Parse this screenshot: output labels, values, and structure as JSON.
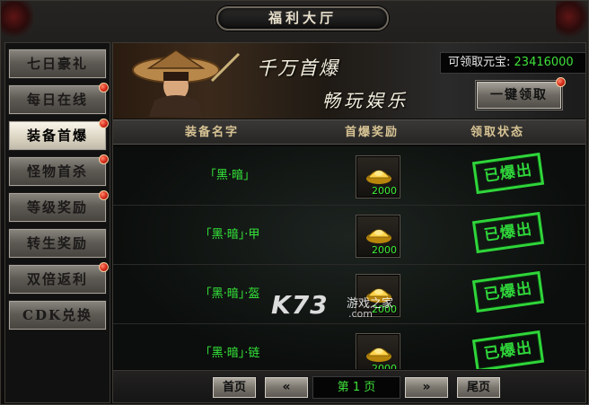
{
  "window": {
    "title": "福利大厅"
  },
  "sidebar": {
    "items": [
      {
        "label": "七日豪礼",
        "badge": false,
        "active": false
      },
      {
        "label": "每日在线",
        "badge": true,
        "active": false
      },
      {
        "label": "装备首爆",
        "badge": true,
        "active": true
      },
      {
        "label": "怪物首杀",
        "badge": true,
        "active": false
      },
      {
        "label": "等级奖励",
        "badge": true,
        "active": false
      },
      {
        "label": "转生奖励",
        "badge": false,
        "active": false
      },
      {
        "label": "双倍返利",
        "badge": true,
        "active": false
      },
      {
        "label": "CDK兑换",
        "badge": false,
        "active": false
      }
    ]
  },
  "banner": {
    "title1": "千万首爆",
    "title2": "畅玩娱乐",
    "yuanbao_label": "可领取元宝:",
    "yuanbao_value": "23416000",
    "claim_all_label": "一键领取",
    "claim_all_badge": true
  },
  "table": {
    "headers": {
      "name": "装备名字",
      "reward": "首爆奖励",
      "status": "领取状态"
    },
    "rows": [
      {
        "name": "「黑·暗」",
        "reward_qty": "2000",
        "reward_icon": "gold-ingot-icon",
        "status": "已爆出"
      },
      {
        "name": "「黑·暗」·甲",
        "reward_qty": "2000",
        "reward_icon": "gold-ingot-icon",
        "status": "已爆出"
      },
      {
        "name": "「黑·暗」·盔",
        "reward_qty": "2000",
        "reward_icon": "gold-ingot-icon",
        "status": "已爆出"
      },
      {
        "name": "「黑·暗」·链",
        "reward_qty": "2000",
        "reward_icon": "gold-ingot-icon",
        "status": "已爆出"
      }
    ]
  },
  "pager": {
    "first_label": "首页",
    "prev_label": "«",
    "page_label": "第 1 页",
    "next_label": "»",
    "last_label": "尾页"
  },
  "watermark": {
    "brand": "K73",
    "cn": "游戏之家",
    "domain": ".com"
  },
  "colors": {
    "accent_green": "#35e83a",
    "header_gold": "#d7c394"
  }
}
